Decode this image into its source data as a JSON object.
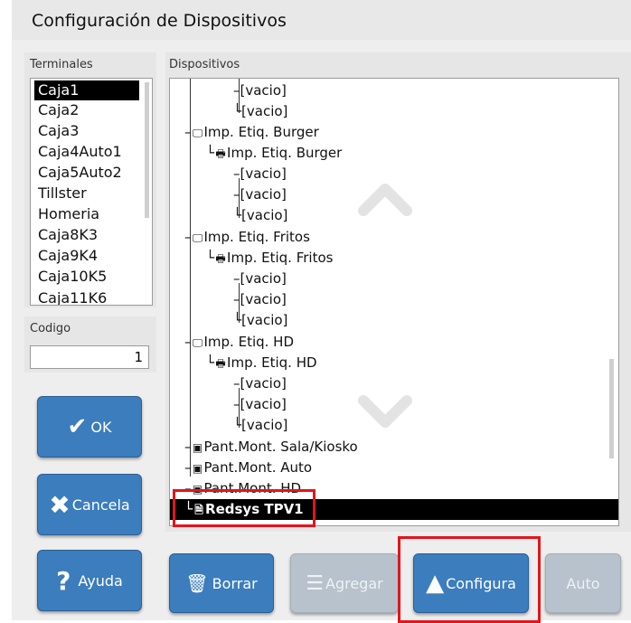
{
  "window": {
    "title": "Configuración de Dispositivos"
  },
  "terminales": {
    "label": "Terminales",
    "items": [
      "Caja1",
      "Caja2",
      "Caja3",
      "Caja4Auto1",
      "Caja5Auto2",
      "Tillster",
      "Homeria",
      "Caja8K3",
      "Caja9K4",
      "Caja10K5",
      "Caja11K6"
    ],
    "selected": "Caja1"
  },
  "codigo": {
    "label": "Codigo",
    "value": "1"
  },
  "dispositivos": {
    "label": "Dispositivos",
    "rows": [
      "[vacio]",
      "[vacio]",
      "Imp. Etiq. Burger",
      "Imp. Etiq. Burger",
      "[vacio]",
      "[vacio]",
      "[vacio]",
      "Imp. Etiq. Fritos",
      "Imp. Etiq. Fritos",
      "[vacio]",
      "[vacio]",
      "[vacio]",
      "Imp. Etiq. HD",
      "Imp. Etiq. HD",
      "[vacio]",
      "[vacio]",
      "[vacio]",
      "Pant.Mont. Sala/Kiosko",
      "Pant.Mont. Auto",
      "Pant.Mont. HD",
      "Redsys TPV1"
    ]
  },
  "buttons": {
    "ok": "OK",
    "cancela": "Cancela",
    "ayuda": "Ayuda",
    "borrar": "Borrar",
    "agregar": "Agregar",
    "configura": "Configura",
    "auto": "Auto"
  },
  "icons": {
    "check": "check-icon",
    "x": "x-icon",
    "question": "question-icon",
    "trash": "trash-icon",
    "list": "list-icon",
    "triangle": "triangle-up-icon"
  },
  "colors": {
    "button_blue": "#3c7dbd",
    "button_disabled": "#b7c2cc",
    "highlight": "#e4141b",
    "selection": "#000000"
  }
}
